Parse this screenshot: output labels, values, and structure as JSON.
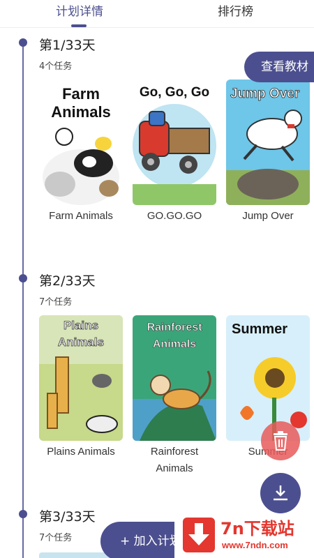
{
  "tabs": {
    "plan_details": "计划详情",
    "leaderboard": "排行榜"
  },
  "view_materials_button": "查看教材",
  "days": [
    {
      "title": "第1/33天",
      "task_count": "4个任务",
      "books": [
        {
          "cover_text": "Farm Animals",
          "label": "Farm Animals"
        },
        {
          "cover_text": "Go, Go, Go",
          "label": "GO.GO.GO"
        },
        {
          "cover_text": "Jump Over",
          "label": "Jump Over"
        }
      ]
    },
    {
      "title": "第2/33天",
      "task_count": "7个任务",
      "books": [
        {
          "cover_text": "Plains Animals",
          "label": "Plains Animals"
        },
        {
          "cover_text": "Rainforest Animals",
          "label": "Rainforest Animals"
        },
        {
          "cover_text": "Summer",
          "label": "Summer"
        }
      ]
    },
    {
      "title": "第3/33天",
      "task_count": "7个任务",
      "books": []
    }
  ],
  "join_button": "+ 加入计划",
  "watermark": {
    "title": "7n下载站",
    "url": "www.7ndn.com"
  },
  "colors": {
    "accent": "#4c4f8f",
    "delete": "#e85a5a",
    "watermark": "#e3372f"
  }
}
